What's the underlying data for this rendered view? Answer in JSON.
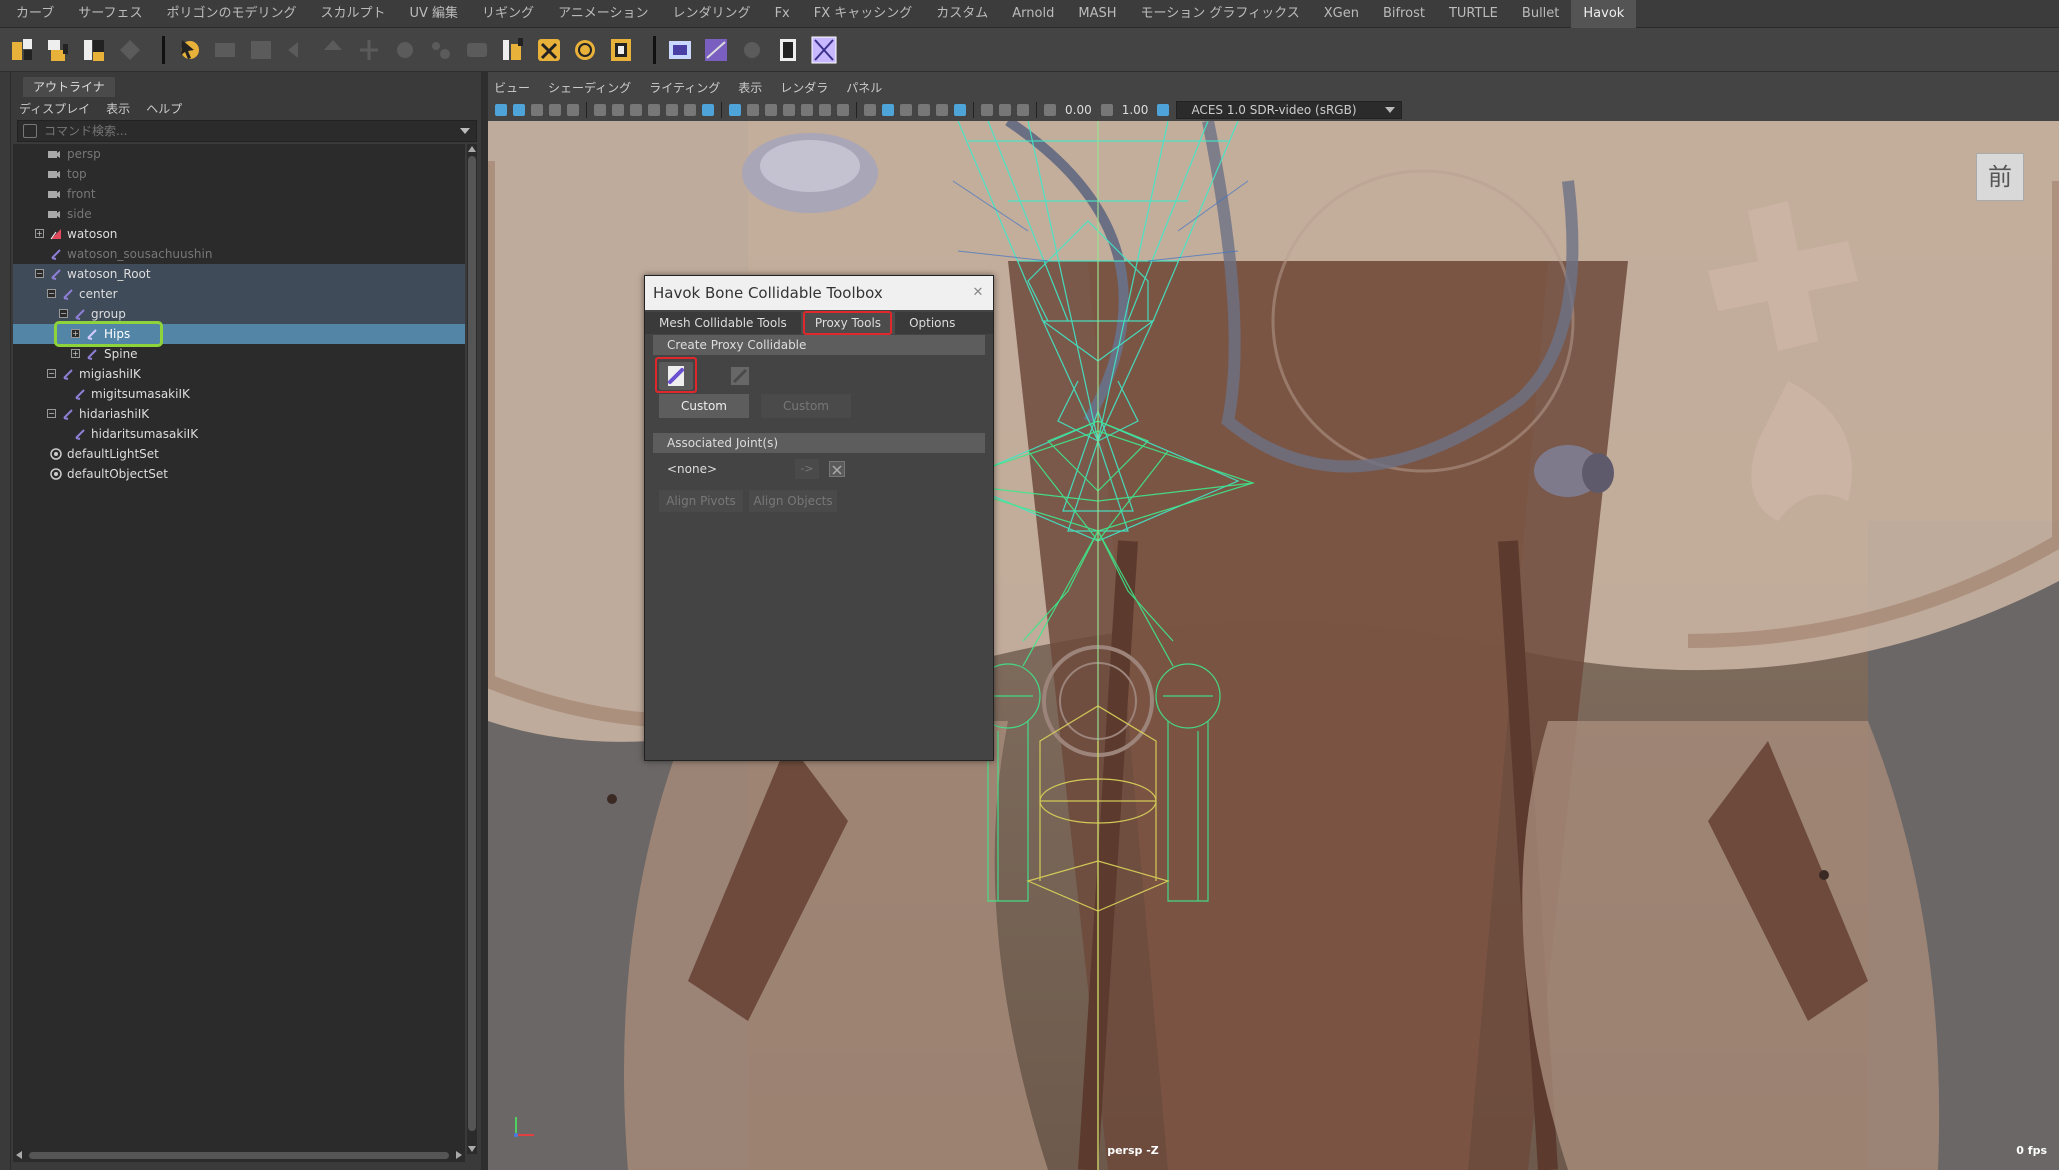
{
  "shelf_tabs": [
    "カーブ",
    "サーフェス",
    "ポリゴンのモデリング",
    "スカルプト",
    "UV 編集",
    "リギング",
    "アニメーション",
    "レンダリング",
    "Fx",
    "FX キャッシング",
    "カスタム",
    "Arnold",
    "MASH",
    "モーション グラフィックス",
    "XGen",
    "Bifrost",
    "TURTLE",
    "Bullet",
    "Havok"
  ],
  "active_shelf": "Havok",
  "outliner": {
    "tab": "アウトライナ",
    "menu": [
      "ディスプレイ",
      "表示",
      "ヘルプ"
    ],
    "search_placeholder": "コマンド検索...",
    "items": [
      {
        "label": "persp",
        "type": "camera"
      },
      {
        "label": "top",
        "type": "camera"
      },
      {
        "label": "front",
        "type": "camera"
      },
      {
        "label": "side",
        "type": "camera"
      },
      {
        "label": "watoson",
        "type": "mesh"
      },
      {
        "label": "watoson_sousachuushin",
        "type": "joint"
      },
      {
        "label": "watoson_Root",
        "type": "joint"
      },
      {
        "label": "center",
        "type": "joint"
      },
      {
        "label": "group",
        "type": "joint"
      },
      {
        "label": "Hips",
        "type": "joint"
      },
      {
        "label": "Spine",
        "type": "joint"
      },
      {
        "label": "migiashiIK",
        "type": "joint"
      },
      {
        "label": "migitsumasakiIK",
        "type": "joint"
      },
      {
        "label": "hidariashiIK",
        "type": "joint"
      },
      {
        "label": "hidaritsumasakiIK",
        "type": "joint"
      },
      {
        "label": "defaultLightSet",
        "type": "set"
      },
      {
        "label": "defaultObjectSet",
        "type": "set"
      }
    ],
    "selected": "Hips"
  },
  "viewport": {
    "menu": [
      "ビュー",
      "シェーディング",
      "ライティング",
      "表示",
      "レンダラ",
      "パネル"
    ],
    "gamma_value": "0.00",
    "exposure_value": "1.00",
    "color_space": "ACES 1.0 SDR-video (sRGB)",
    "view_cube_label": "前",
    "camera_label": "persp -Z",
    "fps": "0 fps"
  },
  "dialog": {
    "title": "Havok Bone Collidable Toolbox",
    "tabs": [
      "Mesh Collidable Tools",
      "Proxy Tools",
      "Options"
    ],
    "active_tab": "Proxy Tools",
    "section_create": "Create Proxy Collidable",
    "custom_button": "Custom",
    "custom_button_disabled": "Custom",
    "section_joints": "Associated Joint(s)",
    "joint_value": "<none>",
    "arrow_button": "->",
    "align_pivots": "Align Pivots",
    "align_objects": "Align Objects"
  },
  "highlight_colors": {
    "red": "#e0282c",
    "green": "#8fd33a",
    "selection": "#5285a6"
  }
}
